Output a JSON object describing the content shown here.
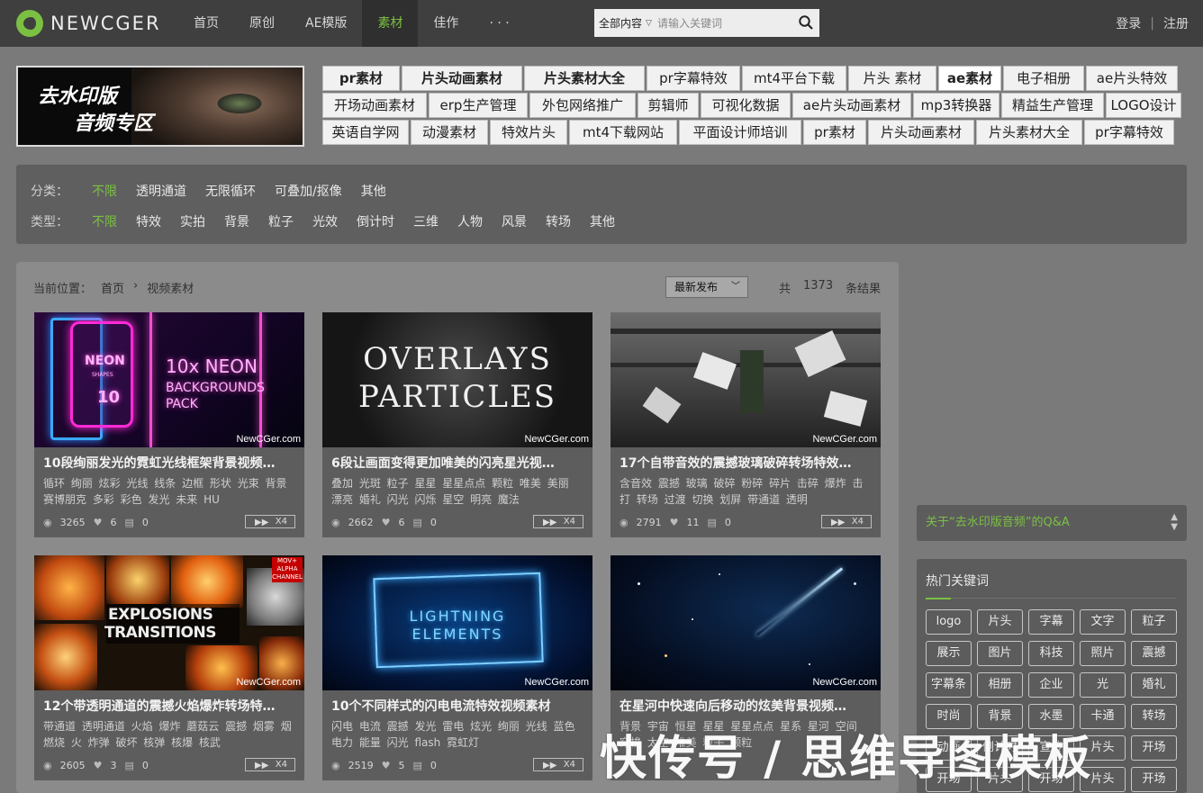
{
  "brand": {
    "name": "NEWCGER"
  },
  "nav": {
    "items": [
      {
        "label": "首页",
        "active": false
      },
      {
        "label": "原创",
        "active": false
      },
      {
        "label": "AE模版",
        "active": false
      },
      {
        "label": "素材",
        "active": true
      },
      {
        "label": "佳作",
        "active": false
      },
      {
        "label": "· · ·",
        "active": false
      }
    ]
  },
  "search": {
    "scope": "全部内容",
    "placeholder": "请输入关键词"
  },
  "auth": {
    "login": "登录",
    "register": "注册"
  },
  "banner": {
    "line1": "去水印版",
    "line2": "音频专区"
  },
  "tag_rows": [
    [
      "pr素材",
      "片头动画素材",
      "片头素材大全",
      "pr字幕特效",
      "mt4平台下载",
      "片头 素材",
      "ae素材",
      "电子相册",
      "ae片头特效"
    ],
    [
      "开场动画素材",
      "erp生产管理",
      "外包网络推广",
      "剪辑师",
      "可视化数据",
      "ae片头动画素材",
      "mp3转换器",
      "精益生产管理",
      "LOGO设计"
    ],
    [
      "英语自学网",
      "动漫素材",
      "特效片头",
      "mt4下载网站",
      "平面设计师培训",
      "pr素材",
      "片头动画素材",
      "片头素材大全",
      "pr字幕特效"
    ]
  ],
  "filter": {
    "category_label": "分类：",
    "categories": [
      "不限",
      "透明通道",
      "无限循环",
      "可叠加/抠像",
      "其他"
    ],
    "type_label": "类型：",
    "types": [
      "不限",
      "特效",
      "实拍",
      "背景",
      "粒子",
      "光效",
      "倒计时",
      "三维",
      "人物",
      "风景",
      "转场",
      "其他"
    ]
  },
  "results": {
    "crumb_label": "当前位置：",
    "crumb_home": "首页",
    "crumb_sep": "›",
    "crumb_current": "视频素材",
    "sort": "最新发布",
    "count_prefix": "共",
    "count": "1373",
    "count_suffix": "条结果"
  },
  "cards": [
    {
      "title": "10段绚丽发光的霓虹光线框架背景视频…",
      "tags": "循环 绚丽 炫彩 光线 线条 边框 形状 光束 背景 赛博朋克 多彩 彩色 发光 未来 HU",
      "views": "3265",
      "likes": "6",
      "comments": "0",
      "quality": "X4",
      "watermark": "NewCGer.com"
    },
    {
      "title": "6段让画面变得更加唯美的闪亮星光视…",
      "tags": "叠加 光斑 粒子 星星 星星点点 颗粒 唯美 美丽 漂亮 婚礼 闪光 闪烁 星空 明亮 魔法",
      "views": "2662",
      "likes": "6",
      "comments": "0",
      "quality": "X4",
      "watermark": "NewCGer.com"
    },
    {
      "title": "17个自带音效的震撼玻璃破碎转场特效…",
      "tags": "含音效 震撼 玻璃 破碎 粉碎 碎片 击碎 爆炸 击打 转场 过渡 切换 划屏 带通道 透明",
      "views": "2791",
      "likes": "11",
      "comments": "0",
      "quality": "X4",
      "watermark": "NewCGer.com"
    },
    {
      "title": "12个带透明通道的震撼火焰爆炸转场特…",
      "tags": "带通道 透明通道 火焰 爆炸 蘑菇云 震撼 烟雾 烟 燃烧 火 炸弹 破坏 核弹 核爆 核武",
      "views": "2605",
      "likes": "3",
      "comments": "0",
      "quality": "X4",
      "watermark": "NewCGer.com"
    },
    {
      "title": "10个不同样式的闪电电流特效视频素材",
      "tags": "闪电 电流 震撼 发光 雷电 炫光 绚丽 光线 蓝色 电力 能量 闪光 flash 霓虹灯",
      "views": "2519",
      "likes": "5",
      "comments": "0",
      "quality": "X4",
      "watermark": "NewCGer.com"
    },
    {
      "title": "在星河中快速向后移动的炫美背景视频…",
      "tags": "背景 宇宙 恒星 星星 星星点点 星系 星河 空间 穿梭 太空 唯美 粒子 颗粒",
      "views": "",
      "likes": "",
      "comments": "",
      "quality": "",
      "watermark": "NewCGer.com"
    }
  ],
  "thumb_text": {
    "neon_small1": "NEON",
    "neon_small2": "SHAPES",
    "neon_small3": "10",
    "neon_l1": "10x NEON",
    "neon_l2": "BACKGROUNDS",
    "neon_l3": "PACK",
    "over_l1": "OVERLAYS",
    "over_l2": "PARTICLES",
    "expl_l1": "EXPLOSIONS",
    "expl_l2": "TRANSITIONS",
    "expl_badge1": "MOV+",
    "expl_badge2": "ALPHA",
    "expl_badge3": "CHANNEL",
    "light_l1": "LIGHTNING",
    "light_l2": "ELEMENTS"
  },
  "sidebar": {
    "qa": "关于“去水印版音频”的Q&A",
    "hot_title": "热门关键词",
    "hot_tags": [
      "logo",
      "片头",
      "字幕",
      "文字",
      "粒子",
      "展示",
      "图片",
      "科技",
      "照片",
      "震撼",
      "字幕条",
      "相册",
      "企业",
      "光",
      "婚礼",
      "时尚",
      "背景",
      "水墨",
      "卡通",
      "转场",
      "动画",
      "倒计时",
      "宣传",
      "片头",
      "开场",
      "开场",
      "片头",
      "开场",
      "片头",
      "开场"
    ]
  },
  "overlay_watermark": "快传号 / 思维导图模板",
  "colors": {
    "accent": "#7bc043",
    "topbar": "#3f3f3f",
    "page_bg": "#7a7a7a"
  }
}
